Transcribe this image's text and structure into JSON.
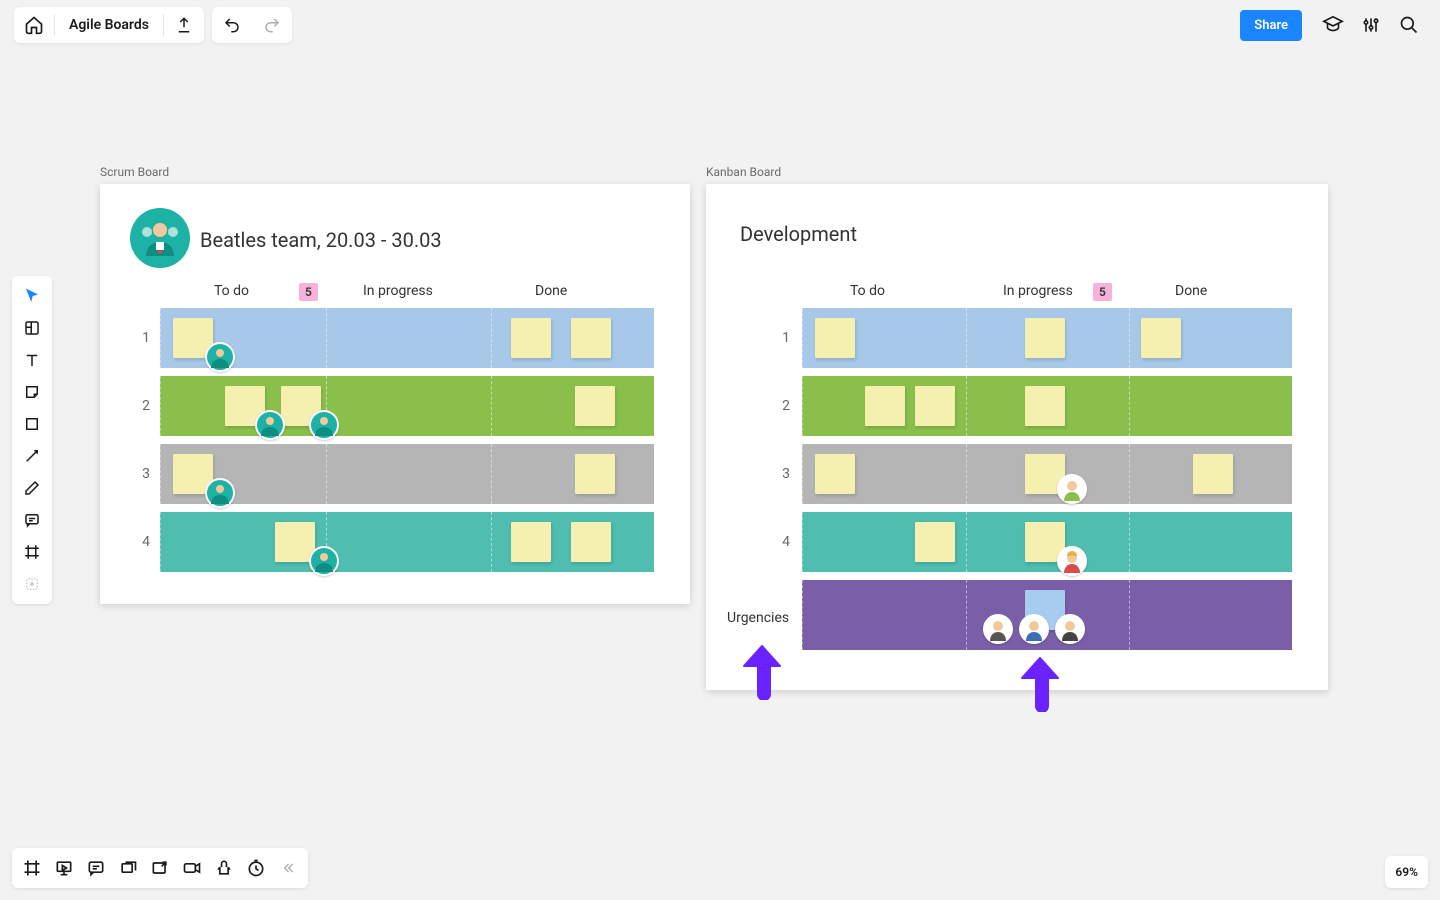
{
  "doc_title": "Agile Boards",
  "share_label": "Share",
  "zoom_label": "69%",
  "frames": {
    "scrum": {
      "label": "Scrum Board",
      "title": "Beatles team, 20.03 - 30.03",
      "columns": [
        "To do",
        "In progress",
        "Done"
      ],
      "badge": "5",
      "rows": [
        "1",
        "2",
        "3",
        "4"
      ]
    },
    "kanban": {
      "label": "Kanban Board",
      "title": "Development",
      "columns": [
        "To do",
        "In progress",
        "Done"
      ],
      "badge": "5",
      "rows": [
        "1",
        "2",
        "3",
        "4"
      ],
      "urgencies_label": "Urgencies"
    }
  },
  "row_colors": [
    "#a7c8e8",
    "#8bbf4c",
    "#b5b5b5",
    "#4fbdb0",
    "#7a5fa8"
  ]
}
